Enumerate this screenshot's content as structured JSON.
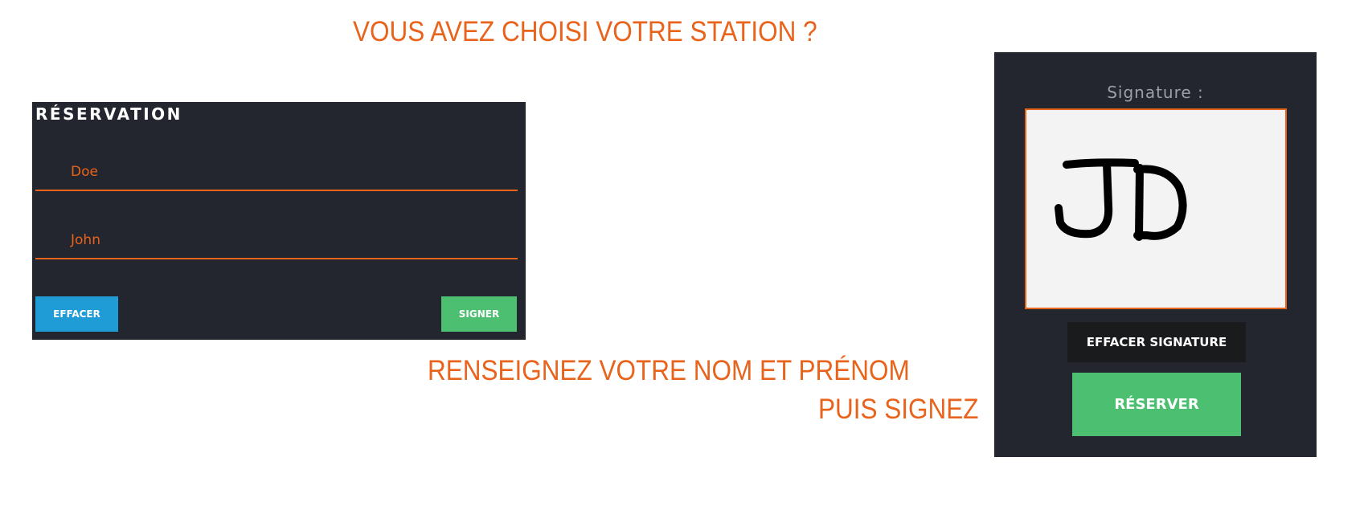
{
  "headings": {
    "top": "VOUS AVEZ CHOISI VOTRE STATION ?",
    "middle": "RENSEIGNEZ VOTRE NOM ET PRÉNOM",
    "bottom": "PUIS SIGNEZ"
  },
  "reservation": {
    "title": "RÉSERVATION",
    "nom_value": "Doe",
    "prenom_value": "John",
    "clear_label": "EFFACER",
    "sign_label": "SIGNER"
  },
  "signature": {
    "label": "Signature :",
    "drawn_initials": "JD",
    "clear_label": "EFFACER SIGNATURE",
    "reserve_label": "RÉSERVER"
  },
  "colors": {
    "accent": "#e8631c",
    "panel": "#23262e",
    "clear_button": "#1f9cd6",
    "confirm_button": "#4cbf71",
    "signature_pad": "#f3f3f3"
  }
}
